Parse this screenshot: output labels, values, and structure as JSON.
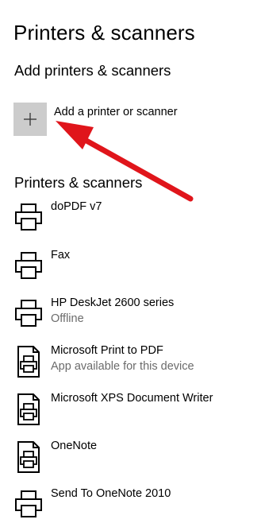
{
  "page": {
    "title": "Printers & scanners"
  },
  "add_section": {
    "title": "Add printers & scanners",
    "add_button_label": "Add a printer or scanner",
    "icon": "plus-icon"
  },
  "list_section": {
    "title": "Printers & scanners",
    "items": [
      {
        "name": "doPDF v7",
        "status": "",
        "icon": "printer-icon"
      },
      {
        "name": "Fax",
        "status": "",
        "icon": "printer-icon"
      },
      {
        "name": "HP DeskJet 2600 series",
        "status": "Offline",
        "icon": "printer-icon"
      },
      {
        "name": "Microsoft Print to PDF",
        "status": "App available for this device",
        "icon": "document-printer-icon"
      },
      {
        "name": "Microsoft XPS Document Writer",
        "status": "",
        "icon": "document-printer-icon"
      },
      {
        "name": "OneNote",
        "status": "",
        "icon": "document-printer-icon"
      },
      {
        "name": "Send To OneNote 2010",
        "status": "",
        "icon": "printer-icon"
      }
    ]
  },
  "annotation": {
    "arrow_color": "#e0151b"
  }
}
